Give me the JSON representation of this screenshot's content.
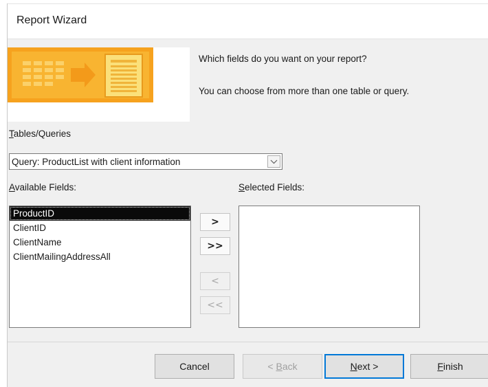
{
  "window": {
    "title": "Report Wizard"
  },
  "prompt": {
    "question": "Which fields do you want on your report?",
    "hint": "You can choose from more than one table or query."
  },
  "tables_queries": {
    "label_mnemonic": "T",
    "label_rest": "ables/Queries",
    "selected_value": "Query: ProductList with client information"
  },
  "available_fields": {
    "label_mnemonic": "A",
    "label_rest": "vailable Fields:",
    "items": [
      "ProductID",
      "ClientID",
      "ClientName",
      "ClientMailingAddressAll"
    ],
    "selected_index": 0
  },
  "selected_fields": {
    "label_mnemonic": "S",
    "label_rest": "elected Fields:",
    "items": []
  },
  "movers": {
    "add_one": ">",
    "add_all": ">>",
    "remove_one": "<",
    "remove_all": "<<"
  },
  "buttons": {
    "cancel": "Cancel",
    "back_prefix": "< ",
    "back_mnemonic": "B",
    "back_rest": "ack",
    "next_mnemonic": "N",
    "next_rest": "ext >",
    "finish_mnemonic": "F",
    "finish_rest": "inish"
  },
  "icons": {
    "banner": "report-wizard-illustration",
    "combo_dropdown": "chevron-down-icon"
  },
  "colors": {
    "banner_orange": "#f6a21e",
    "banner_yellow": "#f9d34a",
    "default_button_border": "#0078d7",
    "selection_bg": "#0a0a0a"
  }
}
